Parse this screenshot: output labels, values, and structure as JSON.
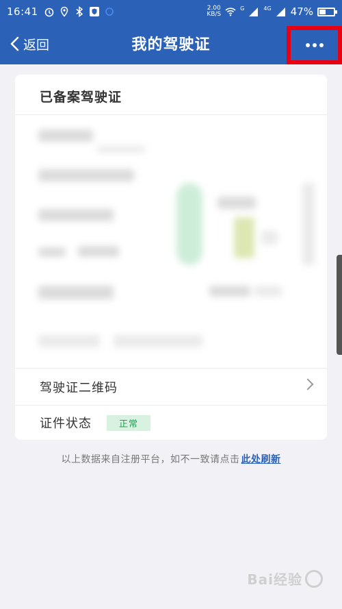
{
  "status_bar": {
    "time": "16:41",
    "net_speed_value": "2.00",
    "net_speed_unit": "KB/S",
    "signal_1_label": "G",
    "signal_2_label": "4G",
    "battery_percent": "47%",
    "battery_level": 0.47,
    "icons": [
      "alarm-icon",
      "location-icon",
      "bluetooth-icon",
      "shield-icon",
      "wifi-icon",
      "signal-icon",
      "battery-icon"
    ]
  },
  "nav": {
    "back_label": "返回",
    "title": "我的驾驶证",
    "more_icon": "more-dots-icon"
  },
  "card": {
    "title": "已备案驾驶证",
    "qr_row_label": "驾驶证二维码",
    "status_row_label": "证件状态",
    "status_badge": "正常"
  },
  "footer": {
    "note": "以上数据来自注册平台，如不一致请点击",
    "refresh_link": "此处刷新"
  },
  "watermark": {
    "text": "Bai经验"
  },
  "colors": {
    "header_blue": "#2b62b8",
    "highlight_red": "#e60012",
    "badge_green_bg": "#d8f1e1",
    "badge_green_text": "#2a9a57",
    "background": "#f2f2f6"
  }
}
